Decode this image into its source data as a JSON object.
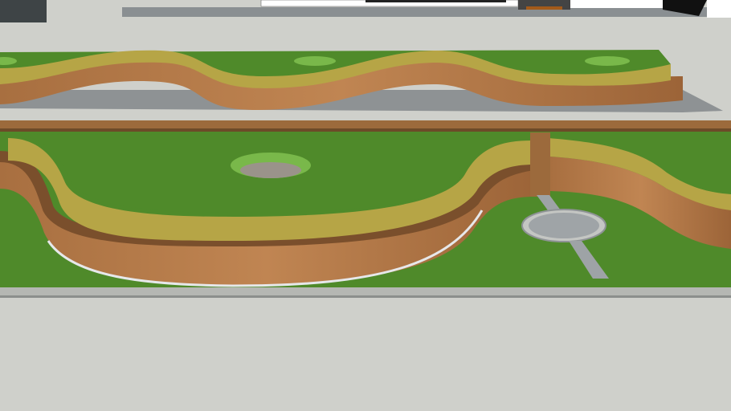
{
  "scene": {
    "colors": {
      "ground": "#cfd0cb",
      "pavement": "#8e9294",
      "grass": "#4f8a2a",
      "grass_light": "#5e9a34",
      "wall_top": "#b6a546",
      "wall_face": "#b07a48",
      "wall_dark": "#7a4f2c",
      "stone": "#a09c96",
      "building": "#ffffff"
    }
  }
}
